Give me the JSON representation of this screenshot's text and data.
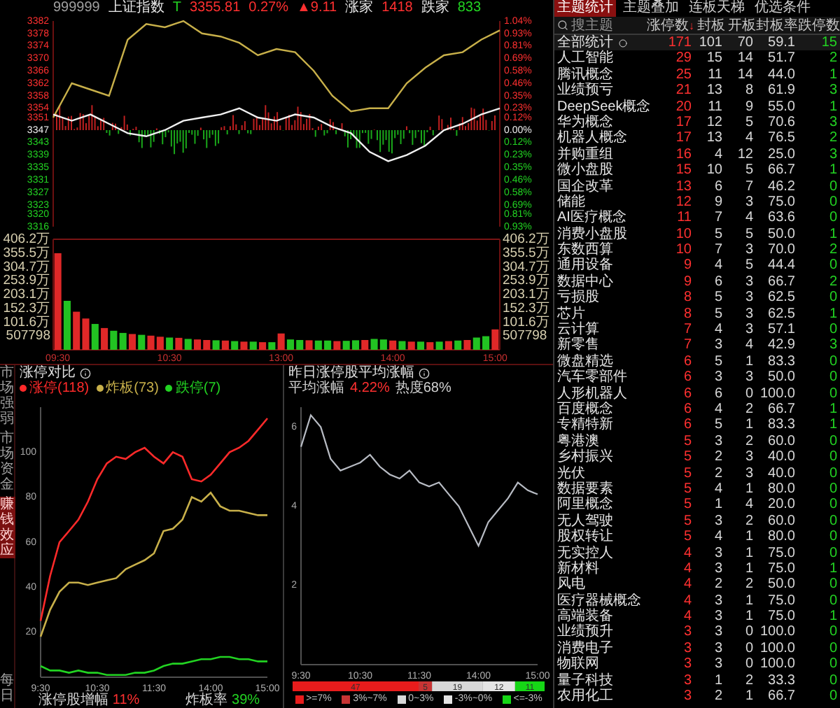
{
  "quote_header": [
    {
      "text": "999999",
      "kind": "code"
    },
    {
      "text": "上证指数",
      "kind": "name"
    },
    {
      "text": "T",
      "kind": "flag"
    },
    {
      "text": "3355.81",
      "kind": "up"
    },
    {
      "text": "0.27%",
      "kind": "up"
    },
    {
      "text": "▲9.11",
      "kind": "up"
    },
    {
      "text": "涨家",
      "kind": "name"
    },
    {
      "text": "1418",
      "kind": "up"
    },
    {
      "text": "跌家",
      "kind": "name"
    },
    {
      "text": "833",
      "kind": "down"
    }
  ],
  "index_chart": {
    "right_axis": [
      {
        "text": "1.04%",
        "kind": "up"
      },
      {
        "text": "0.93%",
        "kind": "up"
      },
      {
        "text": "0.81%",
        "kind": "up"
      },
      {
        "text": "0.69%",
        "kind": "up"
      },
      {
        "text": "0.58%",
        "kind": "up"
      },
      {
        "text": "0.46%",
        "kind": "up"
      },
      {
        "text": "0.35%",
        "kind": "up"
      },
      {
        "text": "0.23%",
        "kind": "up"
      },
      {
        "text": "0.12%",
        "kind": "up"
      },
      {
        "text": "0.00%",
        "kind": "flat"
      },
      {
        "text": "0.12%",
        "kind": "down"
      },
      {
        "text": "0.23%",
        "kind": "down"
      },
      {
        "text": "0.35%",
        "kind": "down"
      },
      {
        "text": "0.46%",
        "kind": "down"
      },
      {
        "text": "0.58%",
        "kind": "down"
      },
      {
        "text": "0.69%",
        "kind": "down"
      },
      {
        "text": "0.81%",
        "kind": "down"
      },
      {
        "text": "0.93%",
        "kind": "down"
      }
    ],
    "chart_data": {
      "type": "line",
      "ylim": [
        3316,
        3382
      ],
      "yticks": [
        {
          "value": 3382,
          "label": "3382"
        },
        {
          "value": 3378,
          "label": "3378"
        },
        {
          "value": 3374,
          "label": "3374"
        },
        {
          "value": 3370,
          "label": "3370"
        },
        {
          "value": 3366,
          "label": "3366"
        },
        {
          "value": 3362,
          "label": "3362"
        },
        {
          "value": 3358,
          "label": "3358"
        },
        {
          "value": 3354,
          "label": "3354"
        },
        {
          "value": 3351,
          "label": "3351"
        },
        {
          "value": 3347,
          "label": "3347"
        },
        {
          "value": 3343,
          "label": "3343"
        },
        {
          "value": 3339,
          "label": "3339"
        },
        {
          "value": 3335,
          "label": "3335"
        },
        {
          "value": 3331,
          "label": "3331"
        },
        {
          "value": 3327,
          "label": "3327"
        },
        {
          "value": 3323,
          "label": "3323"
        },
        {
          "value": 3320,
          "label": "3320"
        },
        {
          "value": 3316,
          "label": "3316"
        }
      ],
      "series": [
        {
          "color": "#c8b04a",
          "values": [
            3351,
            3362,
            3360,
            3358,
            3376,
            3381,
            3380,
            3382,
            3378,
            3377,
            3375,
            3371,
            3373,
            3372,
            3366,
            3358,
            3353,
            3354,
            3354,
            3362,
            3367,
            3371,
            3372,
            3376,
            3379
          ]
        },
        {
          "color": "#f0f0f0",
          "values": [
            3352,
            3350,
            3352,
            3349,
            3346,
            3345,
            3347,
            3350,
            3351,
            3352,
            3354,
            3351,
            3350,
            3352,
            3351,
            3348,
            3346,
            3340,
            3337,
            3339,
            3342,
            3347,
            3349,
            3352,
            3354
          ]
        }
      ]
    }
  },
  "volume_chart": {
    "base_label": "507798",
    "right_axis": [
      "406.2万",
      "355.5万",
      "304.7万",
      "253.9万",
      "203.1万",
      "152.3万",
      "101.6万",
      "507798"
    ],
    "chart_data": {
      "type": "bar",
      "categories": [
        "09:30",
        null,
        null,
        null,
        null,
        null,
        null,
        null,
        null,
        null,
        null,
        null,
        "10:30",
        null,
        null,
        null,
        null,
        null,
        null,
        null,
        null,
        null,
        null,
        null,
        "13:00",
        null,
        null,
        null,
        null,
        null,
        null,
        null,
        null,
        null,
        null,
        null,
        "14:00",
        null,
        null,
        null,
        null,
        null,
        null,
        null,
        null,
        null,
        null,
        "15:00"
      ],
      "ylim": [
        0,
        406.2
      ],
      "yticks": [
        {
          "value": 406.2,
          "label": "406.2万"
        },
        {
          "value": 355.5,
          "label": "355.5万"
        },
        {
          "value": 304.7,
          "label": "304.7万"
        },
        {
          "value": 253.9,
          "label": "253.9万"
        },
        {
          "value": 203.1,
          "label": "203.1万"
        },
        {
          "value": 152.3,
          "label": "152.3万"
        },
        {
          "value": 101.6,
          "label": "101.6万"
        }
      ],
      "series": [
        {
          "color": "#e02828",
          "values": [
            355,
            null,
            140,
            115,
            null,
            80,
            null,
            null,
            58,
            null,
            52,
            48,
            null,
            44,
            null,
            38,
            36,
            null,
            34,
            null,
            30,
            null,
            28,
            null,
            60,
            null,
            null,
            35,
            null,
            null,
            32,
            null,
            null,
            36,
            null,
            null,
            34,
            null,
            30,
            null,
            28,
            null,
            32,
            null,
            36,
            null,
            null,
            75
          ]
        },
        {
          "color": "#22c322",
          "values": [
            null,
            180,
            null,
            null,
            95,
            null,
            70,
            62,
            null,
            55,
            null,
            null,
            45,
            null,
            40,
            null,
            null,
            35,
            null,
            32,
            null,
            30,
            null,
            28,
            null,
            38,
            36,
            null,
            34,
            34,
            null,
            33,
            35,
            null,
            40,
            38,
            null,
            32,
            null,
            30,
            null,
            30,
            null,
            34,
            null,
            45,
            50,
            null
          ]
        }
      ]
    }
  },
  "side_tabs": [
    {
      "label": "市场强弱",
      "selected": false
    },
    {
      "label": "市场资金",
      "selected": false
    },
    {
      "label": "赚钱效应",
      "selected": true
    },
    {
      "label": "每日",
      "selected": false
    }
  ],
  "limit_panel": {
    "title": "涨停对比",
    "chart_data": {
      "type": "line",
      "categories": [
        "9:30",
        null,
        null,
        null,
        null,
        null,
        "10:30",
        null,
        null,
        null,
        null,
        null,
        "11:30",
        null,
        null,
        null,
        null,
        null,
        "14:00",
        null,
        null,
        null,
        null,
        null,
        "15:00"
      ],
      "ylim": [
        0,
        120
      ],
      "yticks": [
        20,
        40,
        60,
        80,
        100
      ],
      "series": [
        {
          "name": "涨停(118)",
          "color": "#ff2a2a",
          "values": [
            25,
            45,
            60,
            65,
            70,
            78,
            88,
            95,
            98,
            97,
            100,
            102,
            98,
            95,
            100,
            98,
            88,
            87,
            90,
            95,
            100,
            102,
            105,
            110,
            115
          ]
        },
        {
          "name": "炸板(73)",
          "color": "#c8b04a",
          "values": [
            18,
            30,
            38,
            42,
            42,
            41,
            42,
            43,
            44,
            48,
            50,
            52,
            55,
            65,
            66,
            70,
            80,
            78,
            82,
            76,
            74,
            74,
            73,
            72,
            72
          ]
        },
        {
          "name": "跌停(7)",
          "color": "#22d322",
          "values": [
            5,
            3,
            3,
            2,
            3,
            2,
            2,
            1,
            1,
            1,
            2,
            2,
            3,
            5,
            6,
            6,
            7,
            8,
            8,
            9,
            9,
            8,
            8,
            7,
            7
          ]
        }
      ]
    },
    "footer": [
      {
        "label": "涨停股增幅",
        "value": "11%",
        "kind": "up"
      },
      {
        "label": "炸板率",
        "value": "39%",
        "kind": "down"
      }
    ]
  },
  "yesterday_panel": {
    "title": "昨日涨停股平均涨幅",
    "avg_label": "平均涨幅",
    "avg_value": "4.22%",
    "heat": "热度68%",
    "chart_data": {
      "type": "line",
      "categories": [
        "9:30",
        null,
        null,
        null,
        null,
        null,
        "10:30",
        null,
        null,
        null,
        null,
        null,
        "11:30",
        null,
        null,
        null,
        null,
        null,
        "14:00",
        null,
        null,
        null,
        null,
        null,
        "15:00"
      ],
      "ylim": [
        0,
        6.5
      ],
      "yticks": [
        2,
        4,
        6
      ],
      "series": [
        {
          "color": "#b8bcc4",
          "values": [
            5.5,
            6.3,
            6.0,
            5.2,
            4.9,
            5.0,
            5.1,
            5.3,
            5.0,
            4.8,
            4.7,
            4.9,
            4.6,
            4.5,
            4.6,
            4.3,
            4.0,
            3.5,
            3.0,
            3.6,
            3.9,
            4.2,
            4.6,
            4.4,
            4.3
          ]
        }
      ]
    },
    "distribution": {
      "chart_data": {
        "type": "bar",
        "orientation": "horizontal",
        "stacked": true,
        "data_labels": true,
        "series": [
          {
            "name": ">=7%",
            "color": "#e81c1c",
            "values": [
              47
            ]
          },
          {
            "name": "3%~7%",
            "color": "#c83434",
            "values": [
              5
            ]
          },
          {
            "name": "0~3%",
            "color": "#d8d8d8",
            "values": [
              19
            ]
          },
          {
            "name": "-3%~0%",
            "color": "#e4e4e4",
            "values": [
              12
            ]
          },
          {
            "name": "<=-3%",
            "color": "#16d616",
            "values": [
              11
            ]
          }
        ]
      }
    }
  },
  "theme_tabs": [
    {
      "label": "主题统计",
      "selected": true
    },
    {
      "label": "主题叠加",
      "selected": false
    },
    {
      "label": "连板天梯",
      "selected": false
    },
    {
      "label": "优选条件",
      "selected": false
    }
  ],
  "theme_table": {
    "search_placeholder": "搜主题",
    "columns": [
      "涨停数",
      "封板",
      "开板",
      "封板率",
      "跌停数"
    ],
    "sort_mark": "↓",
    "rows": [
      {
        "kind": "total",
        "name": "全部统计",
        "limit_up": "171",
        "sealed": "101",
        "opened": "70",
        "seal_rate": "59.1",
        "limit_down": "15"
      },
      {
        "kind": "theme",
        "name": "人工智能",
        "limit_up": "29",
        "sealed": "15",
        "opened": "14",
        "seal_rate": "51.7",
        "limit_down": "2"
      },
      {
        "kind": "theme",
        "name": "腾讯概念",
        "limit_up": "25",
        "sealed": "11",
        "opened": "14",
        "seal_rate": "44.0",
        "limit_down": "1"
      },
      {
        "kind": "theme",
        "name": "业绩预亏",
        "limit_up": "21",
        "sealed": "13",
        "opened": "8",
        "seal_rate": "61.9",
        "limit_down": "3"
      },
      {
        "kind": "theme",
        "name": "DeepSeek概念",
        "limit_up": "20",
        "sealed": "11",
        "opened": "9",
        "seal_rate": "55.0",
        "limit_down": "1"
      },
      {
        "kind": "theme",
        "name": "华为概念",
        "limit_up": "17",
        "sealed": "12",
        "opened": "5",
        "seal_rate": "70.6",
        "limit_down": "3"
      },
      {
        "kind": "theme",
        "name": "机器人概念",
        "limit_up": "17",
        "sealed": "13",
        "opened": "4",
        "seal_rate": "76.5",
        "limit_down": "2"
      },
      {
        "kind": "theme",
        "name": "并购重组",
        "limit_up": "16",
        "sealed": "4",
        "opened": "12",
        "seal_rate": "25.0",
        "limit_down": "3"
      },
      {
        "kind": "theme",
        "name": "微小盘股",
        "limit_up": "15",
        "sealed": "10",
        "opened": "5",
        "seal_rate": "66.7",
        "limit_down": "1"
      },
      {
        "kind": "theme",
        "name": "国企改革",
        "limit_up": "13",
        "sealed": "6",
        "opened": "7",
        "seal_rate": "46.2",
        "limit_down": "0"
      },
      {
        "kind": "theme",
        "name": "储能",
        "limit_up": "12",
        "sealed": "9",
        "opened": "3",
        "seal_rate": "75.0",
        "limit_down": "0"
      },
      {
        "kind": "theme",
        "name": "AI医疗概念",
        "limit_up": "11",
        "sealed": "7",
        "opened": "4",
        "seal_rate": "63.6",
        "limit_down": "0"
      },
      {
        "kind": "theme",
        "name": "消费小盘股",
        "limit_up": "10",
        "sealed": "5",
        "opened": "5",
        "seal_rate": "50.0",
        "limit_down": "1"
      },
      {
        "kind": "theme",
        "name": "东数西算",
        "limit_up": "10",
        "sealed": "7",
        "opened": "3",
        "seal_rate": "70.0",
        "limit_down": "2"
      },
      {
        "kind": "theme",
        "name": "通用设备",
        "limit_up": "9",
        "sealed": "4",
        "opened": "5",
        "seal_rate": "44.4",
        "limit_down": "0"
      },
      {
        "kind": "theme",
        "name": "数据中心",
        "limit_up": "9",
        "sealed": "6",
        "opened": "3",
        "seal_rate": "66.7",
        "limit_down": "2"
      },
      {
        "kind": "theme",
        "name": "亏损股",
        "limit_up": "8",
        "sealed": "5",
        "opened": "3",
        "seal_rate": "62.5",
        "limit_down": "0"
      },
      {
        "kind": "theme",
        "name": "芯片",
        "limit_up": "8",
        "sealed": "5",
        "opened": "3",
        "seal_rate": "62.5",
        "limit_down": "1"
      },
      {
        "kind": "theme",
        "name": "云计算",
        "limit_up": "7",
        "sealed": "4",
        "opened": "3",
        "seal_rate": "57.1",
        "limit_down": "0"
      },
      {
        "kind": "theme",
        "name": "新零售",
        "limit_up": "7",
        "sealed": "3",
        "opened": "4",
        "seal_rate": "42.9",
        "limit_down": "3"
      },
      {
        "kind": "theme",
        "name": "微盘精选",
        "limit_up": "6",
        "sealed": "5",
        "opened": "1",
        "seal_rate": "83.3",
        "limit_down": "0"
      },
      {
        "kind": "theme",
        "name": "汽车零部件",
        "limit_up": "6",
        "sealed": "3",
        "opened": "3",
        "seal_rate": "50.0",
        "limit_down": "0"
      },
      {
        "kind": "theme",
        "name": "人形机器人",
        "limit_up": "6",
        "sealed": "6",
        "opened": "0",
        "seal_rate": "100.0",
        "limit_down": "0"
      },
      {
        "kind": "theme",
        "name": "百度概念",
        "limit_up": "6",
        "sealed": "4",
        "opened": "2",
        "seal_rate": "66.7",
        "limit_down": "1"
      },
      {
        "kind": "theme",
        "name": "专精特新",
        "limit_up": "6",
        "sealed": "5",
        "opened": "1",
        "seal_rate": "83.3",
        "limit_down": "1"
      },
      {
        "kind": "theme",
        "name": "粤港澳",
        "limit_up": "5",
        "sealed": "3",
        "opened": "2",
        "seal_rate": "60.0",
        "limit_down": "0"
      },
      {
        "kind": "theme",
        "name": "乡村振兴",
        "limit_up": "5",
        "sealed": "2",
        "opened": "3",
        "seal_rate": "40.0",
        "limit_down": "0"
      },
      {
        "kind": "theme",
        "name": "光伏",
        "limit_up": "5",
        "sealed": "2",
        "opened": "3",
        "seal_rate": "40.0",
        "limit_down": "0"
      },
      {
        "kind": "theme",
        "name": "数据要素",
        "limit_up": "5",
        "sealed": "4",
        "opened": "1",
        "seal_rate": "80.0",
        "limit_down": "0"
      },
      {
        "kind": "theme",
        "name": "阿里概念",
        "limit_up": "5",
        "sealed": "1",
        "opened": "4",
        "seal_rate": "20.0",
        "limit_down": "0"
      },
      {
        "kind": "theme",
        "name": "无人驾驶",
        "limit_up": "5",
        "sealed": "3",
        "opened": "2",
        "seal_rate": "60.0",
        "limit_down": "0"
      },
      {
        "kind": "theme",
        "name": "股权转让",
        "limit_up": "5",
        "sealed": "4",
        "opened": "1",
        "seal_rate": "80.0",
        "limit_down": "0"
      },
      {
        "kind": "theme",
        "name": "无实控人",
        "limit_up": "4",
        "sealed": "3",
        "opened": "1",
        "seal_rate": "75.0",
        "limit_down": "0"
      },
      {
        "kind": "theme",
        "name": "新材料",
        "limit_up": "4",
        "sealed": "3",
        "opened": "1",
        "seal_rate": "75.0",
        "limit_down": "1"
      },
      {
        "kind": "theme",
        "name": "风电",
        "limit_up": "4",
        "sealed": "2",
        "opened": "2",
        "seal_rate": "50.0",
        "limit_down": "0"
      },
      {
        "kind": "theme",
        "name": "医疗器械概念",
        "limit_up": "4",
        "sealed": "3",
        "opened": "1",
        "seal_rate": "75.0",
        "limit_down": "0"
      },
      {
        "kind": "theme",
        "name": "高端装备",
        "limit_up": "4",
        "sealed": "3",
        "opened": "1",
        "seal_rate": "75.0",
        "limit_down": "1"
      },
      {
        "kind": "theme",
        "name": "业绩预升",
        "limit_up": "3",
        "sealed": "3",
        "opened": "0",
        "seal_rate": "100.0",
        "limit_down": "0"
      },
      {
        "kind": "theme",
        "name": "消费电子",
        "limit_up": "3",
        "sealed": "3",
        "opened": "0",
        "seal_rate": "100.0",
        "limit_down": "0"
      },
      {
        "kind": "theme",
        "name": "物联网",
        "limit_up": "3",
        "sealed": "3",
        "opened": "0",
        "seal_rate": "100.0",
        "limit_down": "0"
      },
      {
        "kind": "theme",
        "name": "量子科技",
        "limit_up": "3",
        "sealed": "1",
        "opened": "2",
        "seal_rate": "33.3",
        "limit_down": "0"
      },
      {
        "kind": "theme",
        "name": "农用化工",
        "limit_up": "3",
        "sealed": "2",
        "opened": "1",
        "seal_rate": "66.7",
        "limit_down": "0"
      }
    ]
  }
}
